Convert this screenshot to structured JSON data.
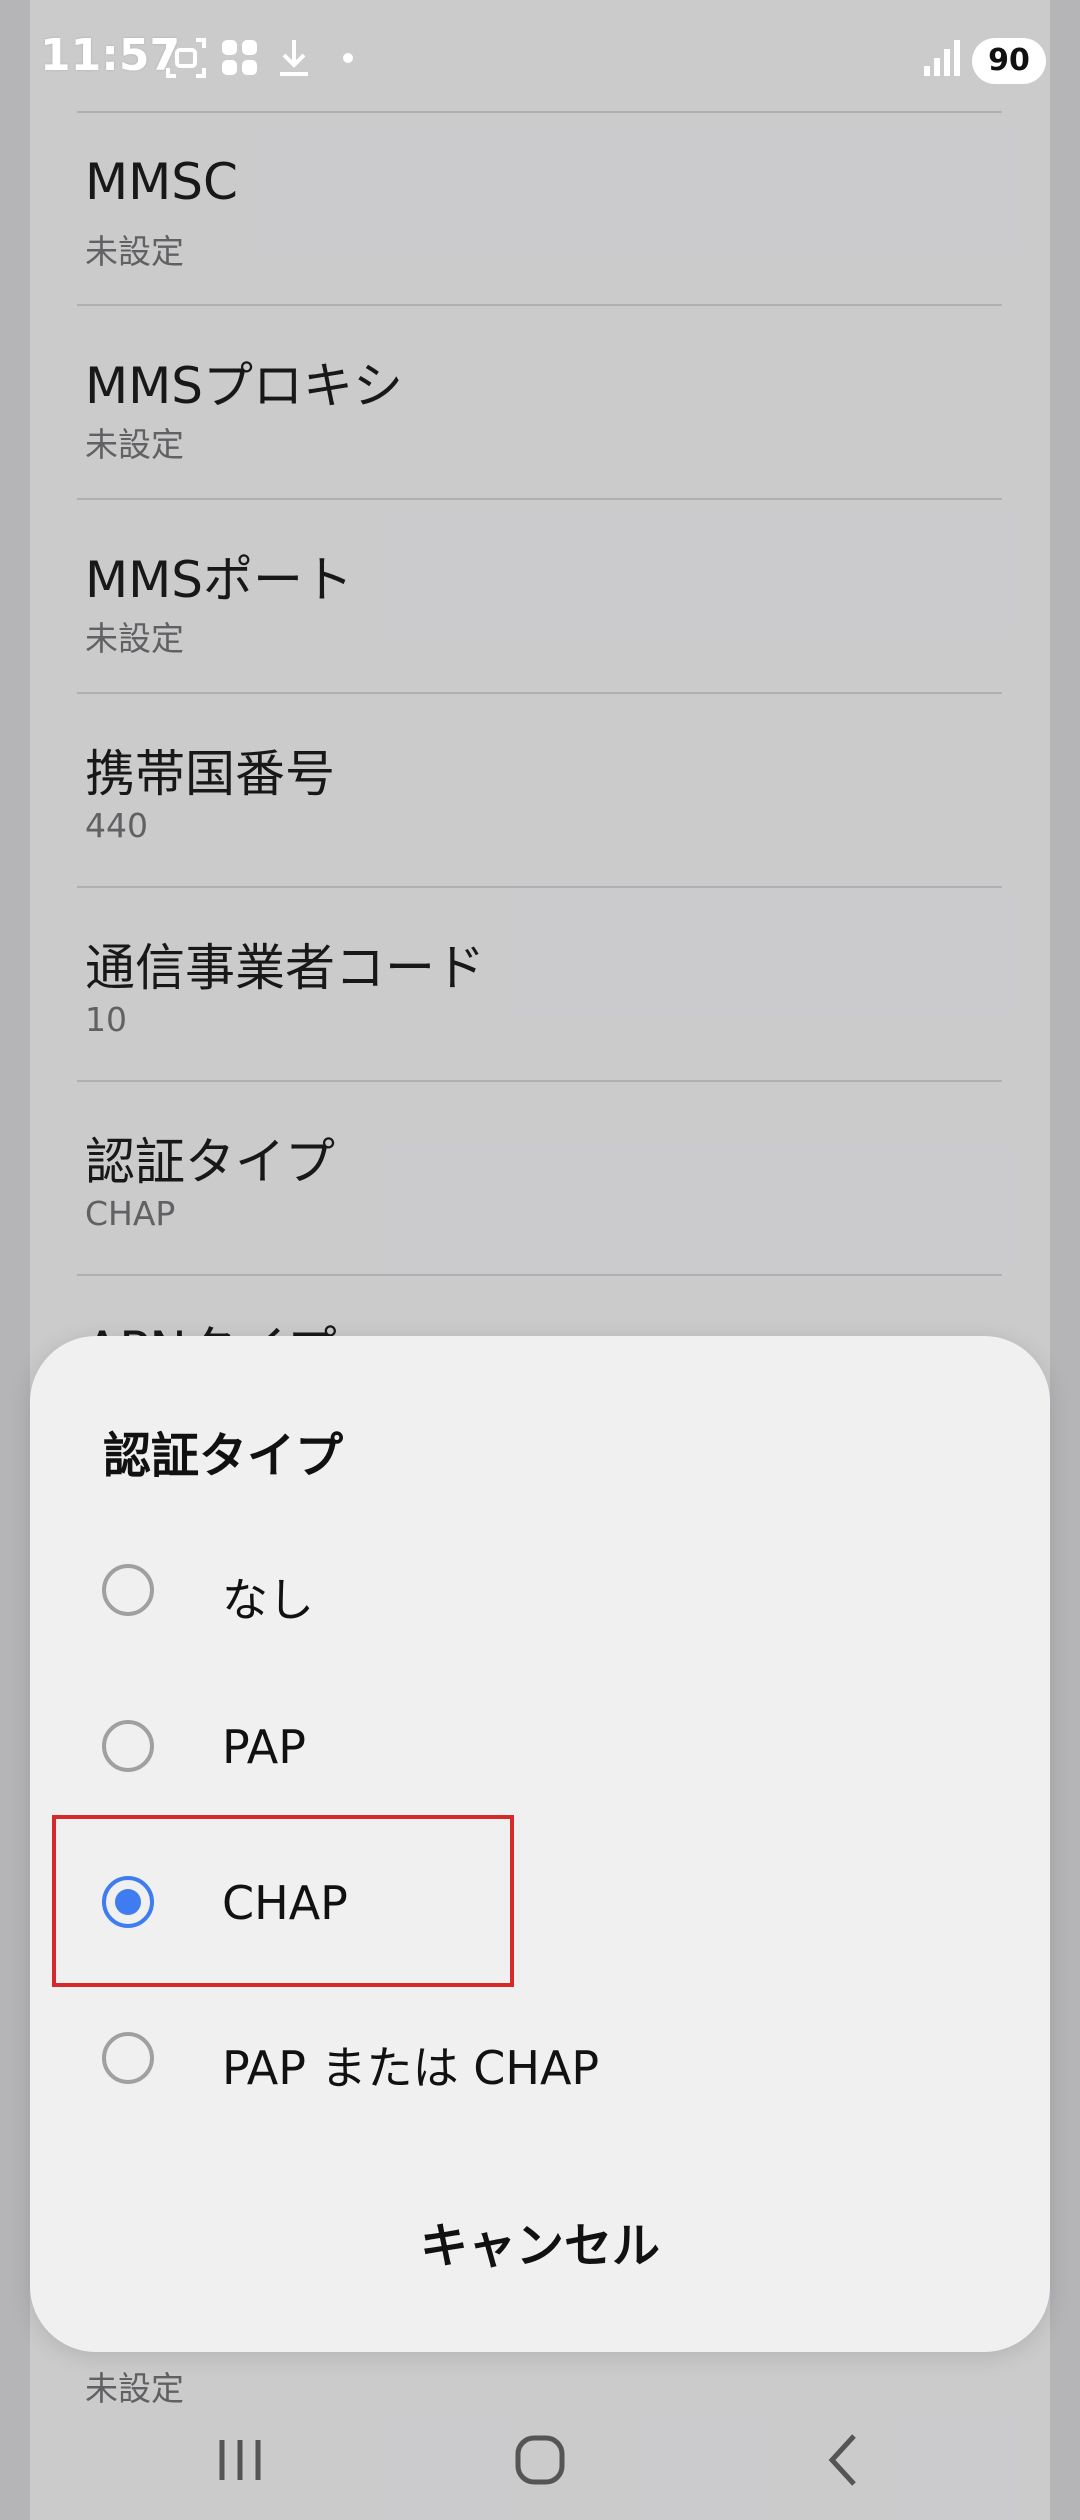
{
  "status_bar": {
    "time": "11:57",
    "battery": "90"
  },
  "settings": {
    "items": [
      {
        "title": "MMSC",
        "value": "未設定"
      },
      {
        "title": "MMSプロキシ",
        "value": "未設定"
      },
      {
        "title": "MMSポート",
        "value": "未設定"
      },
      {
        "title": "携帯国番号",
        "value": "440"
      },
      {
        "title": "通信事業者コード",
        "value": "10"
      },
      {
        "title": "認証タイプ",
        "value": "CHAP"
      }
    ],
    "partial_title": "APNタイプ",
    "bottom_value": "未設定"
  },
  "dialog": {
    "title": "認証タイプ",
    "options": [
      {
        "label": "なし",
        "selected": false
      },
      {
        "label": "PAP",
        "selected": false
      },
      {
        "label": "CHAP",
        "selected": true
      },
      {
        "label": "PAP または CHAP",
        "selected": false
      }
    ],
    "cancel_label": "キャンセル"
  },
  "colors": {
    "accent": "#3e7cf0",
    "highlight": "#d62a2a"
  },
  "icons": {
    "status": [
      "screenshot-icon",
      "app-grid-icon",
      "download-icon",
      "dot-icon",
      "signal-icon"
    ],
    "nav": [
      "recents-icon",
      "home-icon",
      "back-icon"
    ]
  }
}
